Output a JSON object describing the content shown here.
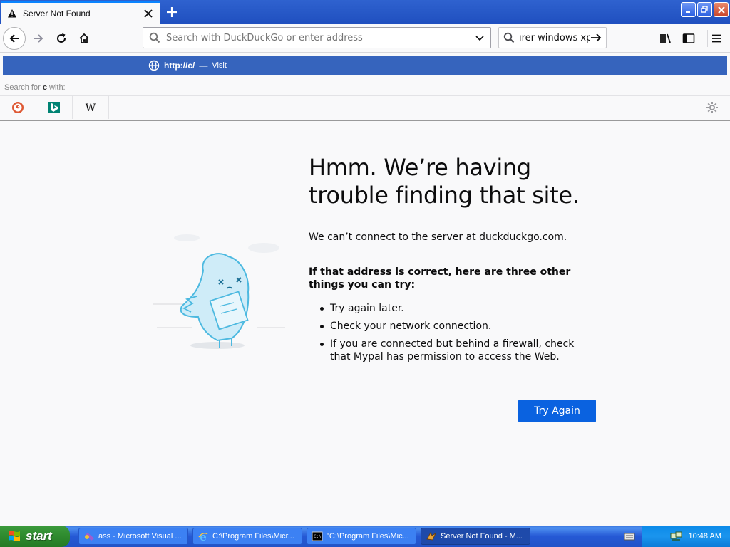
{
  "tabstrip": {
    "active_tab_title": "Server Not Found"
  },
  "navbar": {
    "url_placeholder": "Search with DuckDuckGo or enter address",
    "search_text": "ırer windows xp"
  },
  "popup": {
    "row_url": "http://c/",
    "row_sep": "—",
    "row_action": "Visit",
    "search_for_prefix": "Search for",
    "search_for_term": "c",
    "search_for_suffix": "with:",
    "engines": [
      "duckduckgo-icon",
      "bing-icon",
      "wikipedia-icon"
    ]
  },
  "error": {
    "title": "Hmm. We’re having trouble finding that site.",
    "description": "We can’t connect to the server at duckduckgo.com.",
    "subheading": "If that address is correct, here are three other things you can try:",
    "items": [
      "Try again later.",
      "Check your network connection.",
      "If you are connected but behind a firewall, check that Mypal has permission to access the Web."
    ],
    "button_label": "Try Again"
  },
  "taskbar": {
    "start_label": "start",
    "tasks": [
      {
        "label": "ass - Microsoft Visual ...",
        "icon": "visual-studio-icon"
      },
      {
        "label": "C:\\Program Files\\Micr...",
        "icon": "ie-icon"
      },
      {
        "label": "\"C:\\Program Files\\Mic...",
        "icon": "console-icon"
      },
      {
        "label": "Server Not Found - M...",
        "icon": "mypal-icon"
      }
    ],
    "clock": "10:48 AM"
  },
  "colors": {
    "accent": "#0a62e0",
    "popup_highlight": "#3664bd",
    "taskbar_blue": "#2559d5",
    "start_green": "#2e8a2e"
  }
}
